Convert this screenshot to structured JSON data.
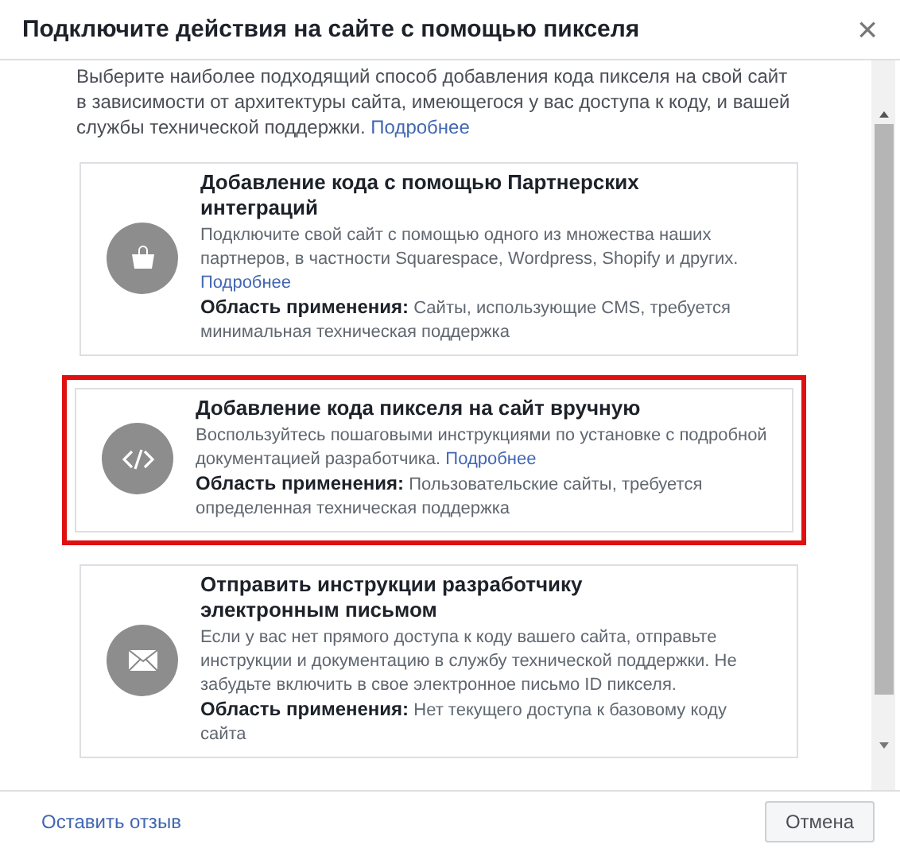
{
  "dialog": {
    "title": "Подключите действия на сайте с помощью пикселя",
    "close": "×"
  },
  "intro": {
    "text": "Выберите наиболее подходящий способ добавления кода пикселя на свой сайт в зависимости от архитектуры сайта, имеющегося у вас доступа к коду, и вашей службы технической поддержки.",
    "link": "Подробнее"
  },
  "options": [
    {
      "kind": "bag",
      "title": "Добавление кода с помощью Партнерских интеграций",
      "description": "Подключите свой сайт с помощью одного из множества наших партнеров, в частности Squarespace, Wordpress, Shopify и других.",
      "link": "Подробнее",
      "scope_label": "Область применения:",
      "scope": "Сайты, использующие CMS, требуется минимальная техническая поддержка",
      "highlighted": false
    },
    {
      "kind": "code",
      "title": "Добавление кода пикселя на сайт вручную",
      "description": "Воспользуйтесь пошаговыми инструкциями по установке с подробной документацией разработчика.",
      "link": "Подробнее",
      "scope_label": "Область применения:",
      "scope": "Пользовательские сайты, требуется определенная техническая поддержка",
      "highlighted": true
    },
    {
      "kind": "mail",
      "title": "Отправить инструкции разработчику электронным письмом",
      "description": "Если у вас нет прямого доступа к коду вашего сайта, отправьте инструкции и документацию в службу технической поддержки. Не забудьте включить в свое электронное письмо ID пикселя.",
      "scope_label": "Область применения:",
      "scope": "Нет текущего доступа к базовому коду сайта",
      "highlighted": false
    }
  ],
  "footer": {
    "feedback_link": "Оставить отзыв",
    "cancel": "Отмена"
  }
}
